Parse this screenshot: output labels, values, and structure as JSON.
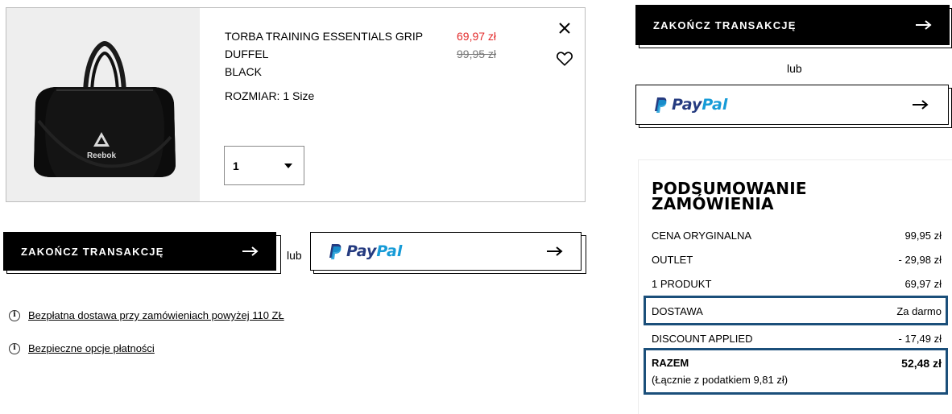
{
  "product": {
    "name_lines": [
      "TORBA TRAINING ESSENTIALS GRIP",
      "DUFFEL",
      "BLACK"
    ],
    "sale_price": "69,97 zł",
    "original_price": "99,95 zł",
    "size_text": "ROZMIAR: 1 Size",
    "quantity": "1",
    "image_brand": "Reebok"
  },
  "actions": {
    "checkout_label": "ZAKOŃCZ TRANSAKCJĘ",
    "or_label": "lub",
    "paypal_pay": "Pay",
    "paypal_pal": "Pal"
  },
  "info": {
    "free_shipping": "Bezpłatna dostawa przy zamówieniach powyżej 110 ZŁ",
    "secure_payment": "Bezpieczne opcje płatności"
  },
  "summary": {
    "title_line1": "PODSUMOWANIE",
    "title_line2": "ZAMÓWIENIA",
    "rows": [
      {
        "label": "CENA ORYGINALNA",
        "value": "99,95 zł"
      },
      {
        "label": "OUTLET",
        "value": "- 29,98 zł"
      },
      {
        "label": "1 PRODUKT",
        "value": "69,97 zł"
      },
      {
        "label": "DOSTAWA",
        "value": "Za darmo"
      },
      {
        "label": "DISCOUNT APPLIED",
        "value": "- 17,49 zł"
      }
    ],
    "total_label": "RAZEM",
    "total_value": "52,48 zł",
    "tax_note": "(Łącznie z podatkiem 9,81 zł)"
  },
  "colors": {
    "sale_price": "#e32b2b",
    "highlight": "#1b4f7a",
    "paypal_dark": "#253b80",
    "paypal_light": "#179bd7"
  },
  "icons": [
    "close-icon",
    "heart-icon",
    "chevron-down-icon",
    "arrow-right-icon",
    "paypal-logo",
    "info-icon"
  ]
}
